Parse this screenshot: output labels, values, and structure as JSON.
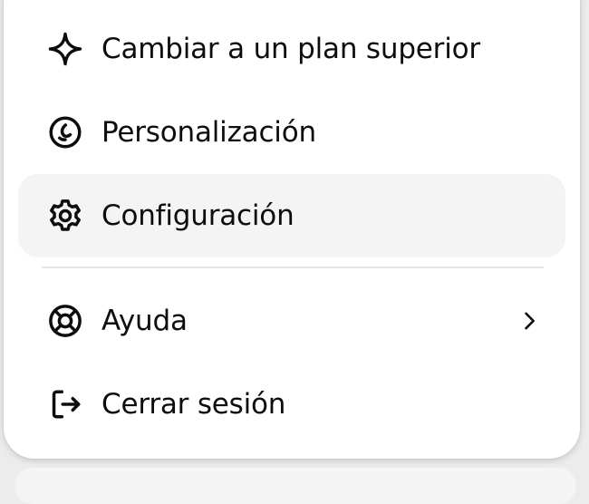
{
  "menu": {
    "items": [
      {
        "label": "Cambiar a un plan superior",
        "icon": "sparkle-icon"
      },
      {
        "label": "Personalización",
        "icon": "personalization-icon"
      },
      {
        "label": "Configuración",
        "icon": "gear-icon",
        "active": true
      },
      {
        "label": "Ayuda",
        "icon": "lifebuoy-icon",
        "has_submenu": true,
        "submenu_icon": "chevron-right-icon"
      },
      {
        "label": "Cerrar sesión",
        "icon": "logout-icon"
      }
    ]
  },
  "colors": {
    "text": "#0d0d0d",
    "menu_background": "#ffffff",
    "hover_background": "#f4f4f4",
    "divider": "#e6e6e6",
    "page_background": "#ececec"
  }
}
